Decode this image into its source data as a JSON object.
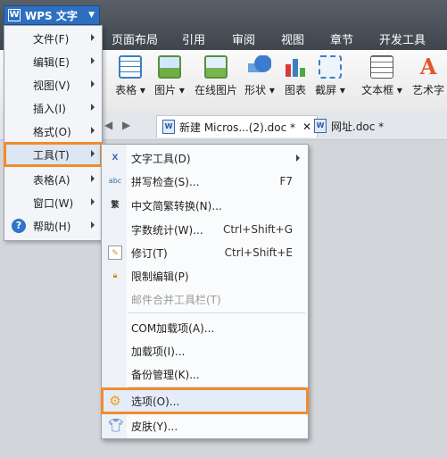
{
  "app": {
    "title": "WPS 文字",
    "logo": "W"
  },
  "top_tabs": [
    "页面布局",
    "引用",
    "审阅",
    "视图",
    "章节",
    "开发工具"
  ],
  "ribbon": {
    "items": [
      {
        "label": "表格 ▾",
        "icon": "table-icon"
      },
      {
        "label": "图片 ▾",
        "icon": "picture-icon"
      },
      {
        "label": "在线图片",
        "icon": "online-picture-icon"
      },
      {
        "label": "形状 ▾",
        "icon": "shapes-icon"
      },
      {
        "label": "图表",
        "icon": "chart-icon"
      },
      {
        "label": "截屏 ▾",
        "icon": "screenshot-icon"
      },
      {
        "label": "文本框 ▾",
        "icon": "textbox-icon"
      },
      {
        "label": "艺术字",
        "icon": "wordart-icon"
      }
    ]
  },
  "doc_tabs": [
    {
      "label": "新建 Micros...(2).doc *",
      "close": "✕",
      "active": true
    },
    {
      "label": "网址.doc *",
      "active": false
    }
  ],
  "main_menu": [
    {
      "label": "文件(F)"
    },
    {
      "label": "编辑(E)"
    },
    {
      "label": "视图(V)"
    },
    {
      "label": "插入(I)"
    },
    {
      "label": "格式(O)"
    },
    {
      "label": "工具(T)",
      "highlighted": true
    },
    {
      "label": "表格(A)"
    },
    {
      "label": "窗口(W)"
    },
    {
      "label": "帮助(H)",
      "icon": "help-icon",
      "icon_glyph": "?"
    }
  ],
  "tools_submenu": [
    {
      "label": "文字工具(D)",
      "icon": "text-tools-icon",
      "submenu": true
    },
    {
      "label": "拼写检查(S)...",
      "shortcut": "F7",
      "icon": "spell-check-icon"
    },
    {
      "label": "中文简繁转换(N)...",
      "icon": "chinese-convert-icon"
    },
    {
      "label": "字数统计(W)...",
      "shortcut": "Ctrl+Shift+G"
    },
    {
      "label": "修订(T)",
      "shortcut": "Ctrl+Shift+E",
      "icon": "track-changes-icon"
    },
    {
      "label": "限制编辑(P)",
      "icon": "lock-icon"
    },
    {
      "label": "邮件合并工具栏(T)",
      "disabled": true
    },
    {
      "label": "COM加载项(A)..."
    },
    {
      "label": "加载项(I)..."
    },
    {
      "label": "备份管理(K)..."
    },
    {
      "label": "选项(O)...",
      "icon": "gear-icon",
      "highlighted": true
    },
    {
      "label": "皮肤(Y)...",
      "icon": "tshirt-icon"
    }
  ],
  "colors": {
    "highlight": "#ef8c2e",
    "accent": "#2d6fc0"
  }
}
